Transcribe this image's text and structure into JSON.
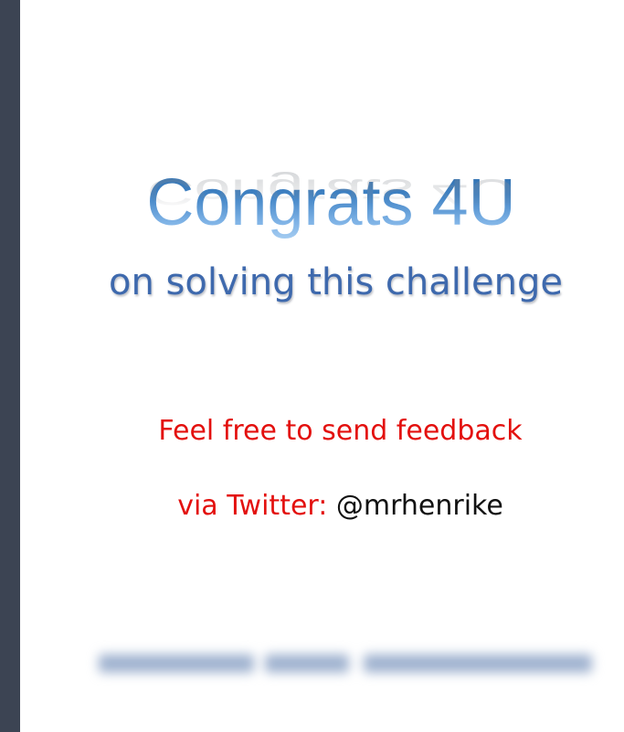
{
  "slide": {
    "title": "Congrats 4U",
    "subtitle": "on solving this challenge",
    "feedback_text": "Feel free to send feedback",
    "twitter_label": "via Twitter:",
    "twitter_handle": "@mrhenrike"
  },
  "colors": {
    "sidebar": "#3c4453",
    "title_blue": "#3f82c4",
    "subtitle_blue": "#3e69ad",
    "feedback_red": "#e3100e",
    "handle_black": "#111111"
  }
}
